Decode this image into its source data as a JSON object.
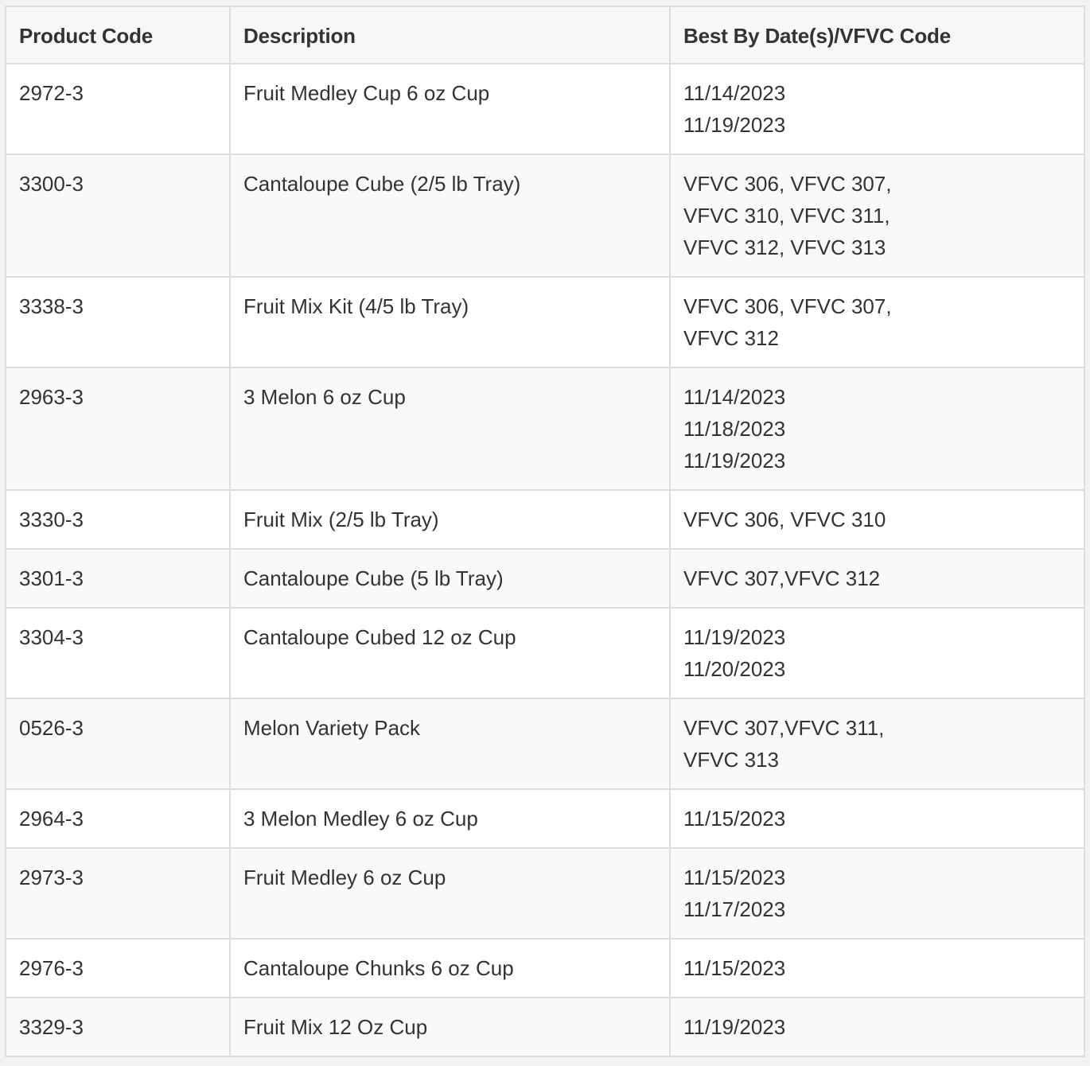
{
  "table": {
    "headers": [
      "Product Code",
      "Description",
      "Best By Date(s)/VFVC Code"
    ],
    "rows": [
      {
        "code": "2972-3",
        "description": "Fruit Medley Cup 6 oz Cup",
        "best_by": [
          "11/14/2023",
          "11/19/2023"
        ]
      },
      {
        "code": "3300-3",
        "description": "Cantaloupe Cube (2/5 lb Tray)",
        "best_by": [
          "VFVC 306, VFVC 307,",
          "VFVC 310, VFVC 311,",
          "VFVC 312, VFVC 313"
        ]
      },
      {
        "code": "3338-3",
        "description": "Fruit Mix Kit (4/5 lb Tray)",
        "best_by": [
          "VFVC 306, VFVC 307,",
          "VFVC 312"
        ]
      },
      {
        "code": "2963-3",
        "description": "3 Melon 6 oz Cup",
        "best_by": [
          "11/14/2023",
          "11/18/2023",
          "11/19/2023"
        ]
      },
      {
        "code": "3330-3",
        "description": "Fruit Mix (2/5 lb Tray)",
        "best_by": [
          "VFVC 306, VFVC 310"
        ]
      },
      {
        "code": "3301-3",
        "description": "Cantaloupe Cube (5 lb Tray)",
        "best_by": [
          "VFVC 307,VFVC 312"
        ]
      },
      {
        "code": "3304-3",
        "description": "Cantaloupe Cubed 12 oz Cup",
        "best_by": [
          "11/19/2023",
          "11/20/2023"
        ]
      },
      {
        "code": "0526-3",
        "description": "Melon Variety Pack",
        "best_by": [
          "VFVC 307,VFVC 311,",
          "VFVC 313"
        ]
      },
      {
        "code": "2964-3",
        "description": "3 Melon Medley 6 oz Cup",
        "best_by": [
          "11/15/2023"
        ]
      },
      {
        "code": "2973-3",
        "description": "Fruit Medley 6 oz Cup",
        "best_by": [
          "11/15/2023",
          "11/17/2023"
        ]
      },
      {
        "code": "2976-3",
        "description": "Cantaloupe Chunks 6 oz Cup",
        "best_by": [
          "11/15/2023"
        ]
      },
      {
        "code": "3329-3",
        "description": "Fruit Mix 12 Oz Cup",
        "best_by": [
          "11/19/2023"
        ]
      }
    ]
  }
}
